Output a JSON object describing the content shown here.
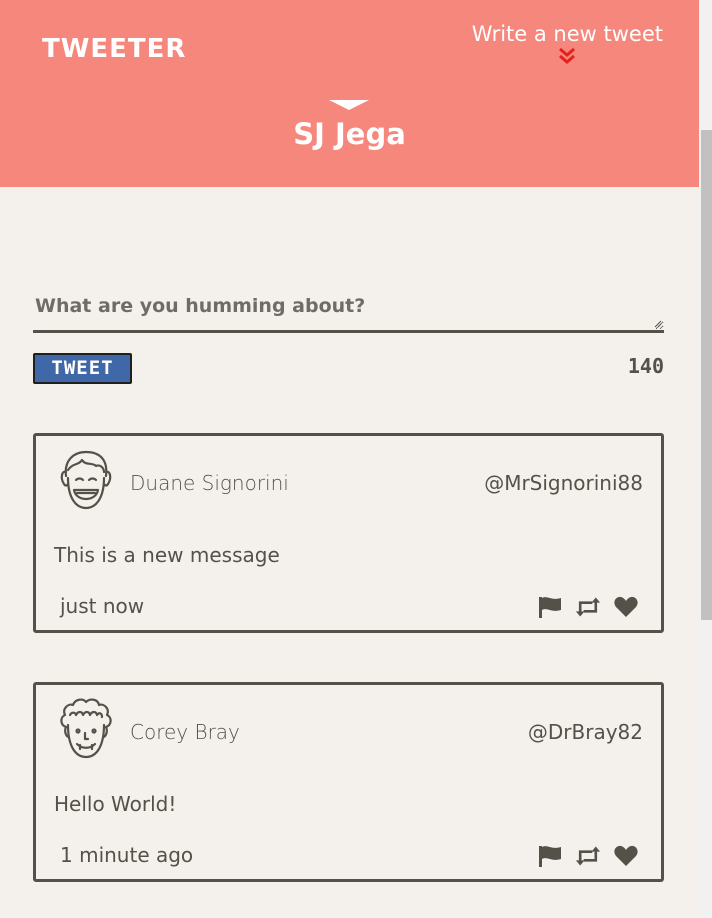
{
  "header": {
    "brand": "TWEETER",
    "compose_toggle_label": "Write a new tweet",
    "username": "SJ Jega"
  },
  "compose": {
    "placeholder": "What are you humming about?",
    "value": "",
    "tweet_button_label": "TWEET",
    "char_counter": "140"
  },
  "tweets": [
    {
      "name": "Duane Signorini",
      "handle": "@MrSignorini88",
      "text": "This is a new message",
      "time": "just now",
      "avatar_icon": "smiling-man-avatar-icon"
    },
    {
      "name": "Corey Bray",
      "handle": "@DrBray82",
      "text": "Hello World!",
      "time": "1 minute ago",
      "avatar_icon": "curly-hair-avatar-icon"
    }
  ],
  "colors": {
    "header_bg": "#f5877d",
    "page_bg": "#f4f1ec",
    "text": "#545149",
    "button_bg": "#4067a7",
    "chevron": "#e8201b"
  }
}
